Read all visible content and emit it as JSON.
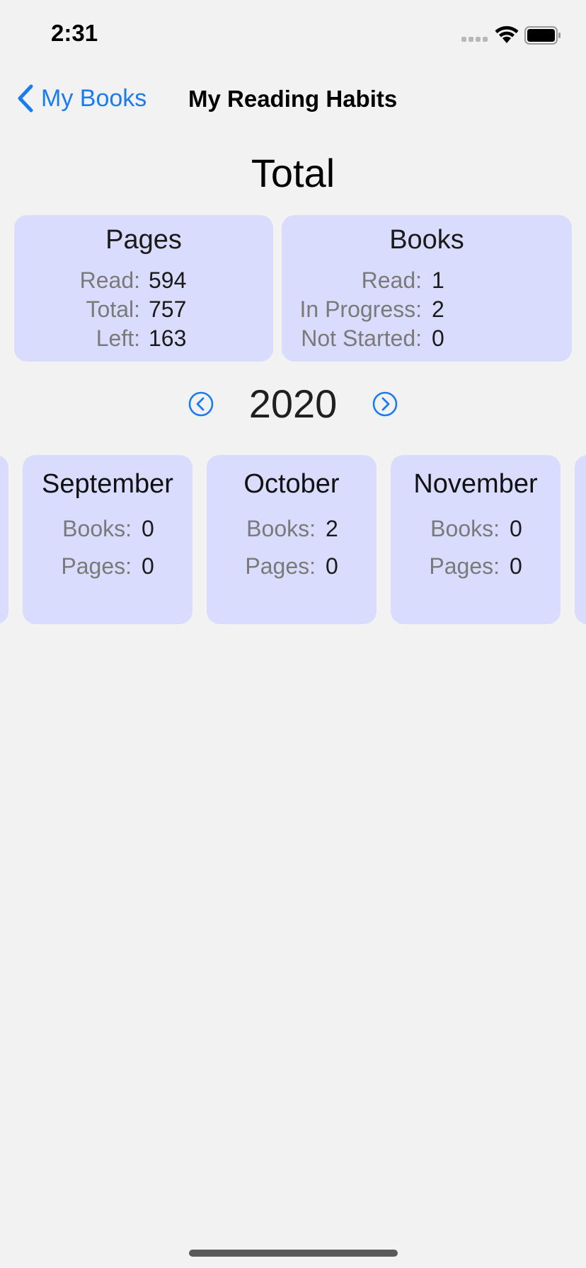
{
  "status_bar": {
    "time": "2:31"
  },
  "nav": {
    "back_label": "My Books",
    "title": "My Reading Habits"
  },
  "section_title": "Total",
  "pages_card": {
    "title": "Pages",
    "rows": [
      {
        "label": "Read:",
        "value": "594"
      },
      {
        "label": "Total:",
        "value": "757"
      },
      {
        "label": "Left:",
        "value": "163"
      }
    ]
  },
  "books_card": {
    "title": "Books",
    "rows": [
      {
        "label": "Read:",
        "value": "1"
      },
      {
        "label": "In Progress:",
        "value": "2"
      },
      {
        "label": "Not Started:",
        "value": "0"
      }
    ]
  },
  "year_selector": {
    "year": "2020",
    "prev_icon": "chevron-left-circle-icon",
    "next_icon": "chevron-right-circle-icon"
  },
  "months": [
    {
      "name": "September",
      "books_label": "Books:",
      "books": "0",
      "pages_label": "Pages:",
      "pages": "0"
    },
    {
      "name": "October",
      "books_label": "Books:",
      "books": "2",
      "pages_label": "Pages:",
      "pages": "0"
    },
    {
      "name": "November",
      "books_label": "Books:",
      "books": "0",
      "pages_label": "Pages:",
      "pages": "0"
    }
  ],
  "colors": {
    "accent": "#1a7cf0",
    "card_bg": "#d9dcfc",
    "page_bg": "#f2f2f2"
  }
}
